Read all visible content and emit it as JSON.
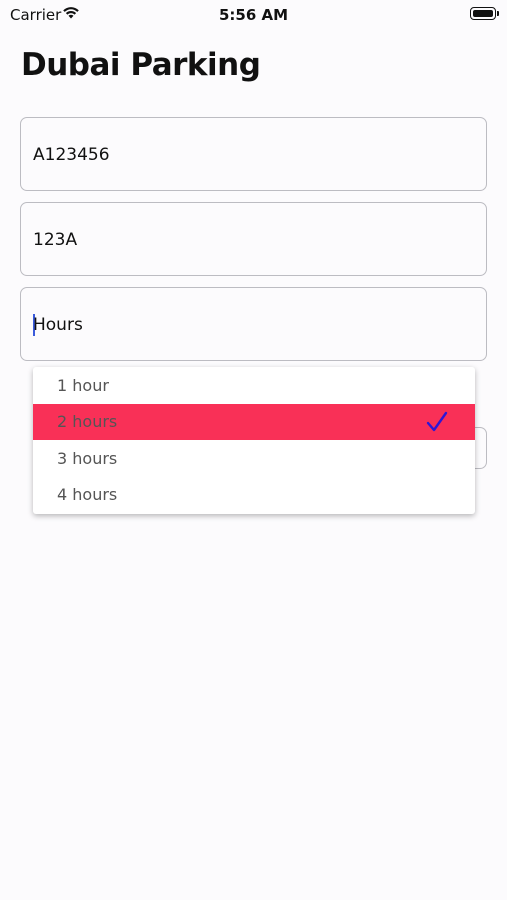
{
  "status_bar": {
    "carrier": "Carrier",
    "time": "5:56 AM"
  },
  "title": "Dubai Parking",
  "form": {
    "fields": [
      {
        "value": "A123456"
      },
      {
        "value": "123A"
      },
      {
        "value": "Hours"
      }
    ]
  },
  "dropdown": {
    "options": [
      "1 hour",
      "2 hours",
      "3 hours",
      "4 hours"
    ],
    "selected": "2 hours"
  },
  "colors": {
    "selected_bg": "#f93057",
    "check": "#2d16d6",
    "cursor": "#3b5bdb"
  },
  "icons": {
    "wifi": "wifi-icon",
    "battery": "battery-icon",
    "check": "checkmark-icon"
  }
}
